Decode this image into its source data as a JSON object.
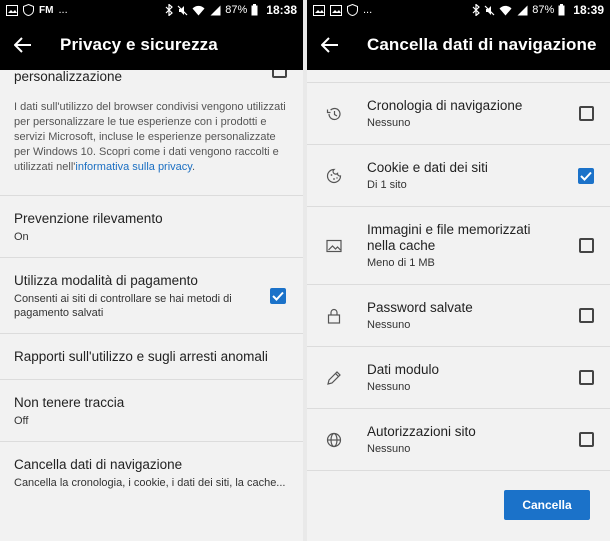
{
  "left": {
    "status": {
      "left_badges": [
        "FM",
        "..."
      ],
      "battery": "87%",
      "time": "18:38"
    },
    "title": "Privacy e sicurezza",
    "top_partial": "personalizzazione",
    "description_text": "I dati sull'utilizzo del browser condivisi vengono utilizzati per personalizzare le tue esperienze con i prodotti e servizi Microsoft, incluse le esperienze personalizzate per Windows 10. Scopri come i dati vengono raccolti e utilizzati nell'",
    "description_link": "informativa sulla privacy",
    "description_end": ".",
    "items": [
      {
        "label": "Prevenzione rilevamento",
        "sub": "On"
      },
      {
        "label": "Utilizza modalità di pagamento",
        "sub": "Consenti ai siti di controllare se hai metodi di pagamento salvati",
        "checked": true
      },
      {
        "label": "Rapporti sull'utilizzo e sugli arresti anomali",
        "sub": ""
      },
      {
        "label": "Non tenere traccia",
        "sub": "Off"
      },
      {
        "label": "Cancella dati di navigazione",
        "sub": "Cancella la cronologia, i cookie, i dati dei siti, la cache..."
      }
    ]
  },
  "right": {
    "status": {
      "left_badges": [
        "..."
      ],
      "battery": "87%",
      "time": "18:39"
    },
    "title": "Cancella dati di navigazione",
    "items": [
      {
        "icon": "history-icon",
        "label": "Cronologia di navigazione",
        "sub": "Nessuno",
        "checked": false
      },
      {
        "icon": "cookie-icon",
        "label": "Cookie e dati dei siti",
        "sub": "Di 1 sito",
        "checked": true
      },
      {
        "icon": "image-icon",
        "label": "Immagini e file memorizzati nella cache",
        "sub": "Meno di 1 MB",
        "checked": false
      },
      {
        "icon": "lock-icon",
        "label": "Password salvate",
        "sub": "Nessuno",
        "checked": false
      },
      {
        "icon": "pencil-icon",
        "label": "Dati modulo",
        "sub": "Nessuno",
        "checked": false
      },
      {
        "icon": "globe-icon",
        "label": "Autorizzazioni sito",
        "sub": "Nessuno",
        "checked": false
      }
    ],
    "button_label": "Cancella"
  },
  "colors": {
    "accent": "#1b72c9",
    "link": "#1b6fc2"
  }
}
